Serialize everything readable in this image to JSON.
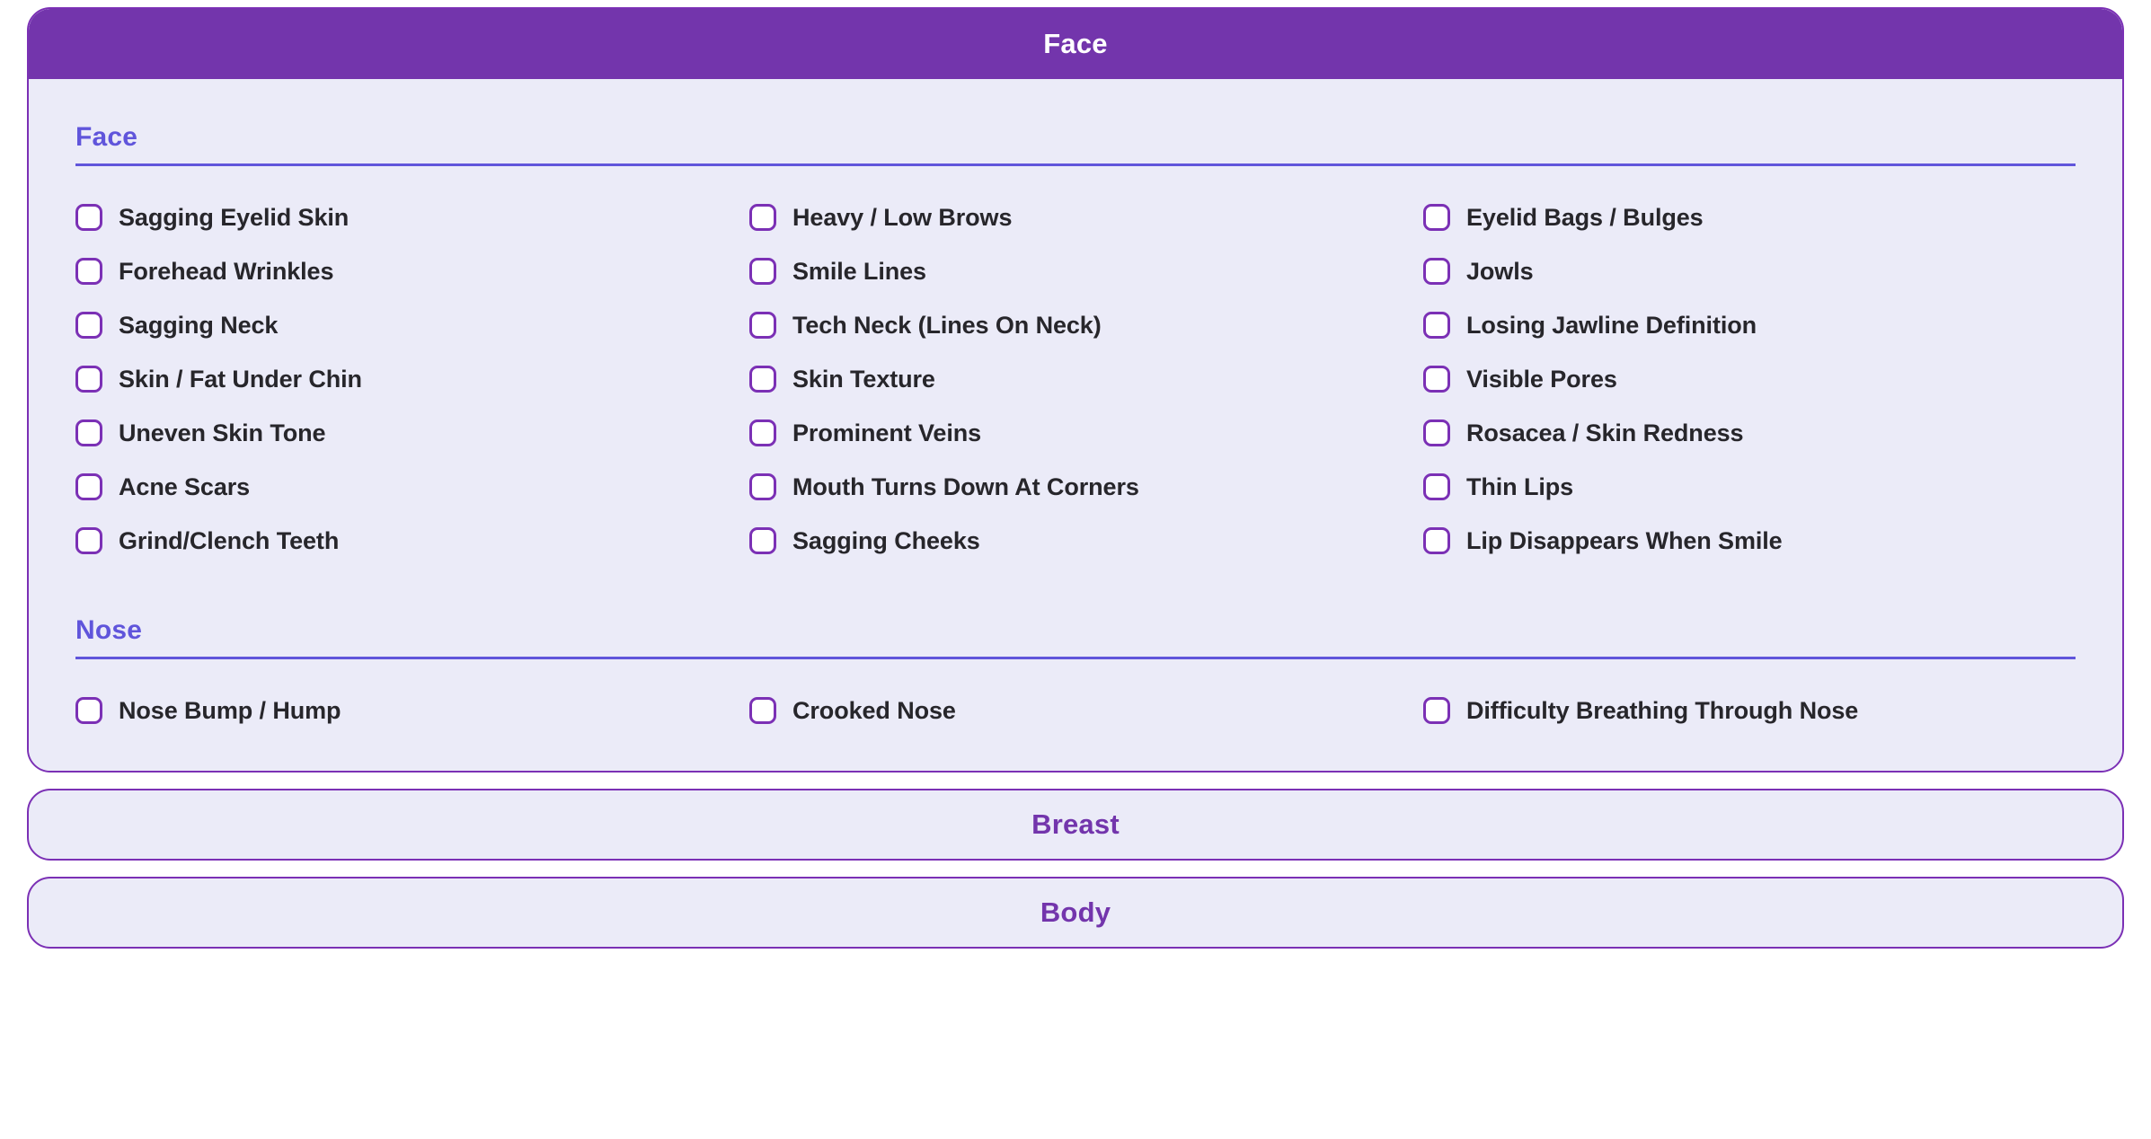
{
  "theme": {
    "header_purple": "#7335AC",
    "border_purple": "#7B30B5",
    "section_indigo": "#6055DB",
    "card_background": "#EBEBF8",
    "label_text": "#27262B",
    "page_background": "#FFFFFF"
  },
  "accordions": [
    {
      "title": "Face",
      "state": "expanded",
      "sections": [
        {
          "title": "Face",
          "items": [
            {
              "label": "Sagging Eyelid Skin",
              "checked": false
            },
            {
              "label": "Heavy / Low Brows",
              "checked": false
            },
            {
              "label": "Eyelid Bags / Bulges",
              "checked": false
            },
            {
              "label": "Forehead Wrinkles",
              "checked": false
            },
            {
              "label": "Smile Lines",
              "checked": false
            },
            {
              "label": "Jowls",
              "checked": false
            },
            {
              "label": "Sagging Neck",
              "checked": false
            },
            {
              "label": "Tech Neck (Lines On Neck)",
              "checked": false
            },
            {
              "label": "Losing Jawline Definition",
              "checked": false
            },
            {
              "label": "Skin / Fat Under Chin",
              "checked": false
            },
            {
              "label": "Skin Texture",
              "checked": false
            },
            {
              "label": "Visible Pores",
              "checked": false
            },
            {
              "label": "Uneven Skin Tone",
              "checked": false
            },
            {
              "label": "Prominent Veins",
              "checked": false
            },
            {
              "label": "Rosacea / Skin Redness",
              "checked": false
            },
            {
              "label": "Acne Scars",
              "checked": false
            },
            {
              "label": "Mouth Turns Down At Corners",
              "checked": false
            },
            {
              "label": "Thin Lips",
              "checked": false
            },
            {
              "label": "Grind/Clench Teeth",
              "checked": false
            },
            {
              "label": "Sagging Cheeks",
              "checked": false
            },
            {
              "label": "Lip Disappears When Smile",
              "checked": false
            }
          ]
        },
        {
          "title": "Nose",
          "items": [
            {
              "label": "Nose Bump / Hump",
              "checked": false
            },
            {
              "label": "Crooked Nose",
              "checked": false
            },
            {
              "label": "Difficulty Breathing Through Nose",
              "checked": false
            }
          ]
        }
      ]
    },
    {
      "title": "Breast",
      "state": "collapsed",
      "sections": []
    },
    {
      "title": "Body",
      "state": "collapsed",
      "sections": []
    }
  ]
}
